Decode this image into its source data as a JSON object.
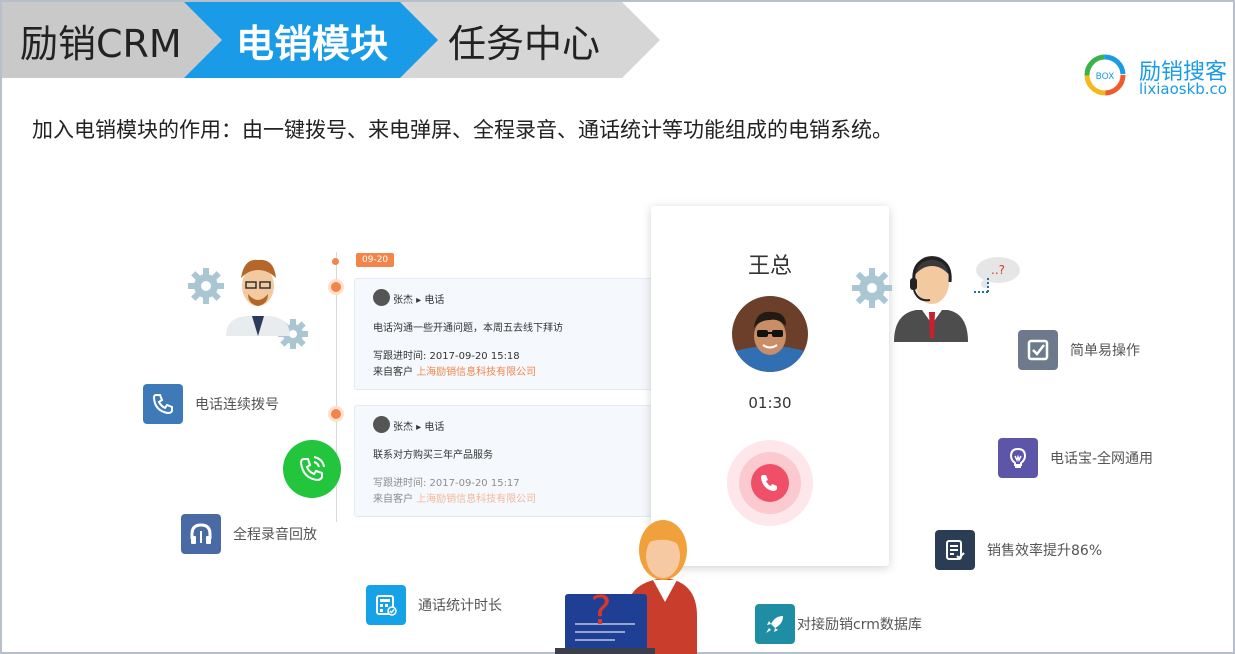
{
  "breadcrumb": [
    {
      "label": "励销CRM"
    },
    {
      "label": "电销模块"
    },
    {
      "label": "任务中心"
    }
  ],
  "logo": {
    "ring_text": "BOX",
    "name": "励销搜客",
    "url": "lixiaoskb.co"
  },
  "intro": "加入电销模块的作用：由一键拨号、来电弹屏、全程录音、通话统计等功能组成的电销系统。",
  "timeline": {
    "date_tag": "09-20",
    "entries": [
      {
        "who": "张杰 ▸ 电话",
        "message": "电话沟通一些开通问题，本周五去线下拜访",
        "time": "写跟进时间: 2017-09-20 15:18",
        "customer_prefix": "来自客户",
        "customer": "上海励销信息科技有限公司"
      },
      {
        "who": "张杰 ▸ 电话",
        "message": "联系对方购买三年产品服务",
        "time": "写跟进时间: 2017-09-20 15:17",
        "customer_prefix": "来自客户",
        "customer": "上海励销信息科技有限公司"
      }
    ]
  },
  "call": {
    "caller": "王总",
    "duration": "01:30"
  },
  "bubble": "..?",
  "features": {
    "left": [
      {
        "label": "电话连续拨号",
        "icon": "phone-icon",
        "color": "#3f7ab8"
      },
      {
        "label": "全程录音回放",
        "icon": "headphone-icon",
        "color": "#4a6aa5"
      },
      {
        "label": "通话统计时长",
        "icon": "calculator-icon",
        "color": "#16a2e6"
      }
    ],
    "right": [
      {
        "label": "简单易操作",
        "icon": "checkbox-icon",
        "color": "#6c7a8c"
      },
      {
        "label": "电话宝-全网通用",
        "icon": "lightbulb-icon",
        "color": "#5d56a8"
      },
      {
        "label": "销售效率提升86%",
        "icon": "document-check-icon",
        "color": "#2a3d55"
      },
      {
        "label": "对接励销crm数据库",
        "icon": "rocket-icon",
        "color": "#1f8ea5"
      }
    ]
  }
}
